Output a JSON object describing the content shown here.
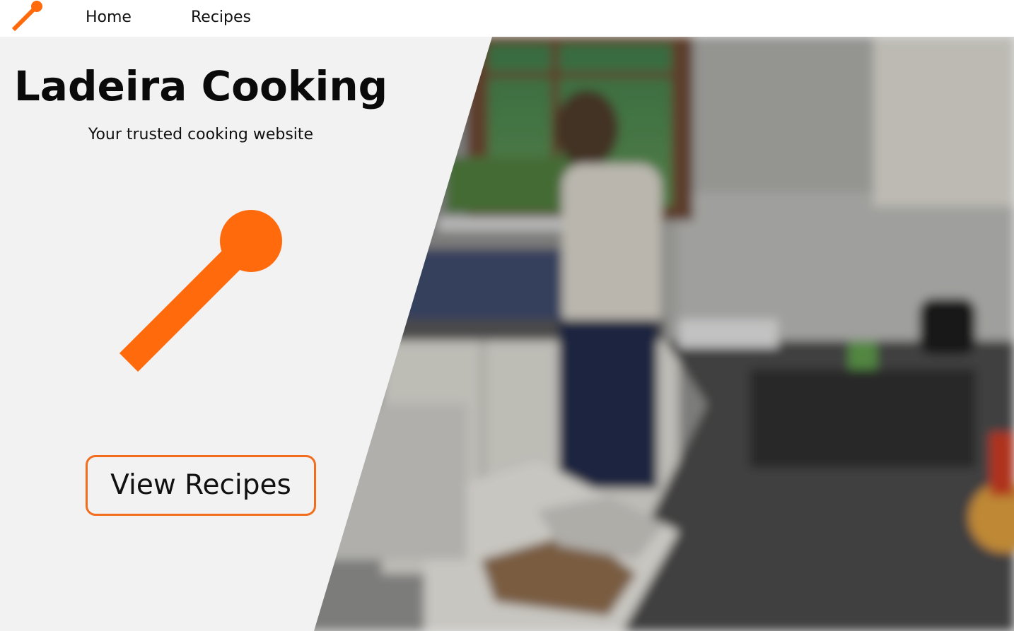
{
  "brand": {
    "logo_icon": "spoon-icon",
    "accent_color": "#ff6a0d"
  },
  "nav": {
    "home_label": "Home",
    "recipes_label": "Recipes"
  },
  "hero": {
    "title": "Ladeira Cooking",
    "subtitle": "Your trusted cooking website",
    "cta_label": "View Recipes",
    "panel_color": "#f2f2f2",
    "cta_border_color": "#f26d1d",
    "logo_icon": "spoon-icon",
    "background_image": "blurred-kitchen-photo"
  }
}
